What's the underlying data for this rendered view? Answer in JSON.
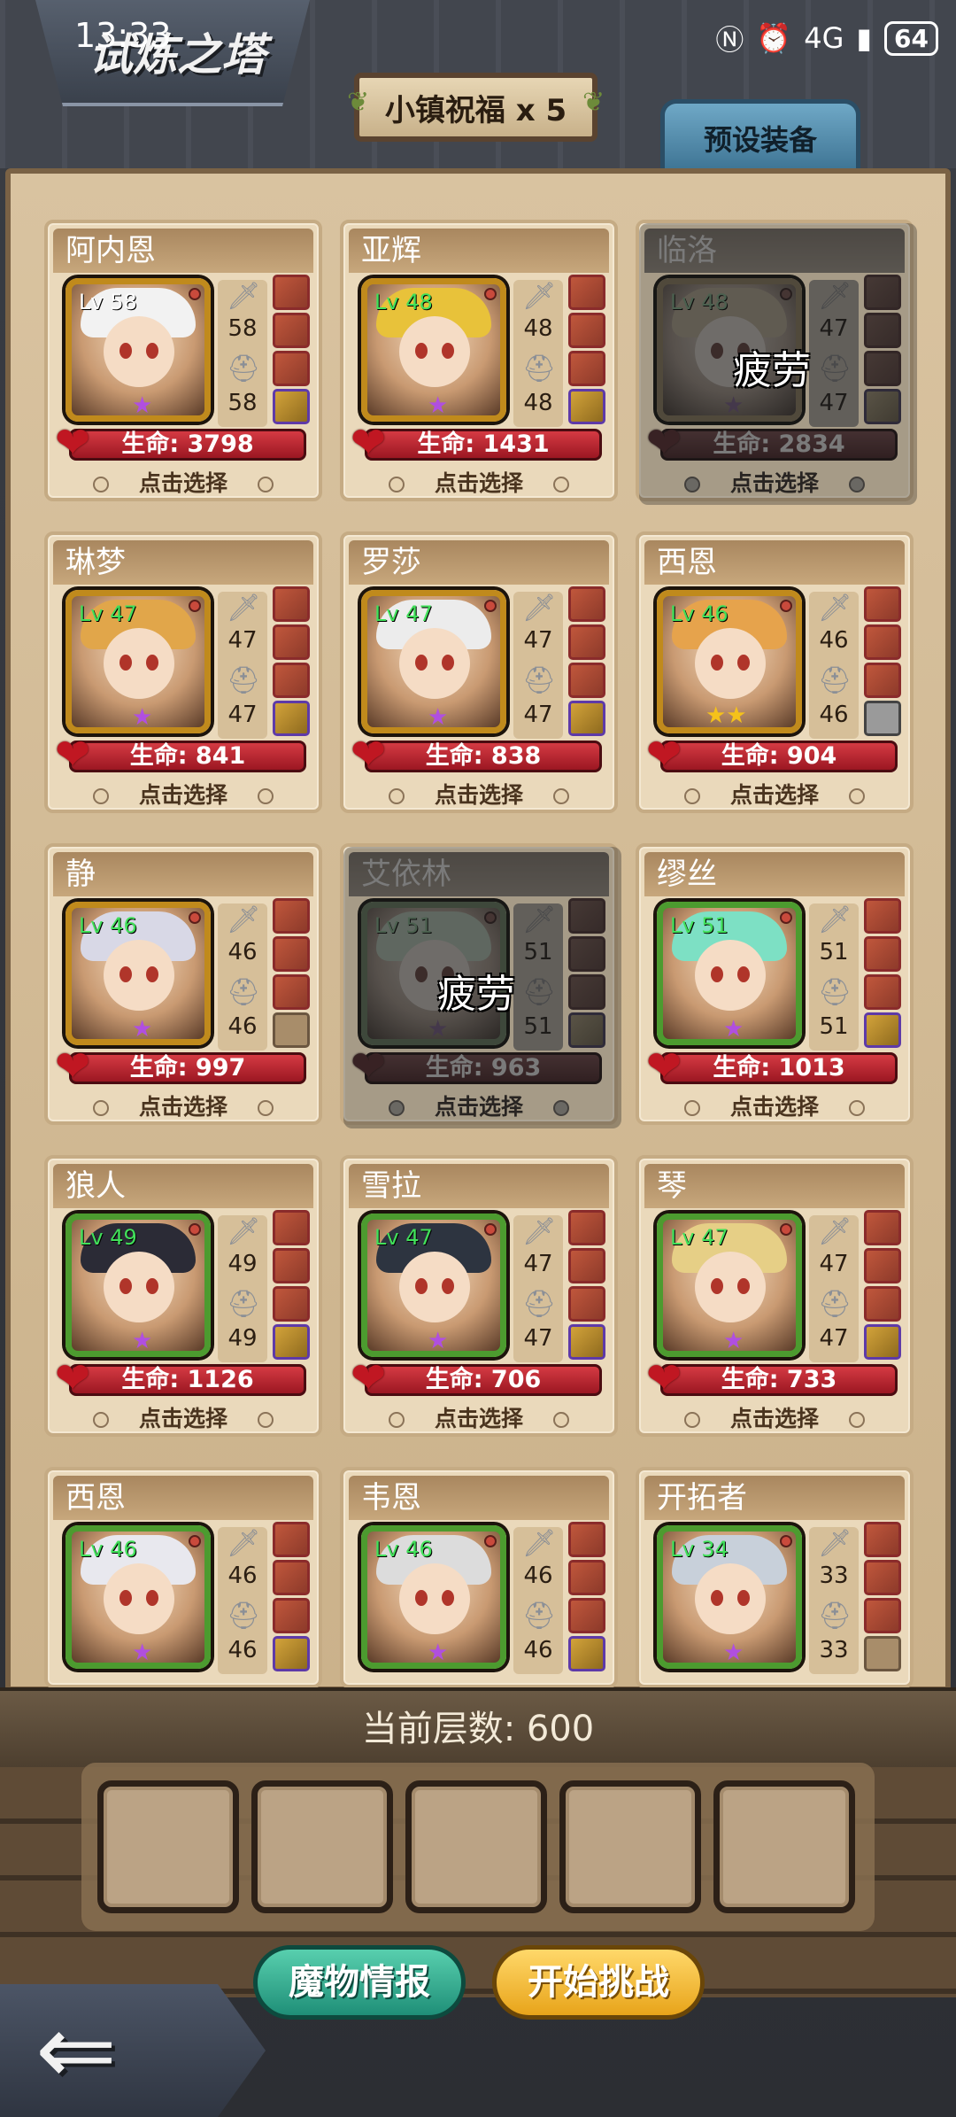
{
  "status_bar": {
    "time": "13:33",
    "signal": "4G",
    "battery": "64"
  },
  "header": {
    "title": "试炼之塔",
    "blessing": "小镇祝福 x 5",
    "preset_tab": "预设装备"
  },
  "heroes": [
    {
      "name": "阿内恩",
      "level": "Lv 58",
      "atk": "58",
      "def": "58",
      "hp": "生命: 3798",
      "select": "点击选择",
      "fatigued": false,
      "frame": "gold"
    },
    {
      "name": "亚辉",
      "level": "Lv 48",
      "atk": "48",
      "def": "48",
      "hp": "生命: 1431",
      "select": "点击选择",
      "fatigued": false,
      "frame": "gold"
    },
    {
      "name": "临洛",
      "level": "Lv 48",
      "atk": "47",
      "def": "47",
      "hp": "生命: 2834",
      "select": "点击选择",
      "fatigued": true,
      "fatigue_label": "疲劳",
      "frame": "gold"
    },
    {
      "name": "琳梦",
      "level": "Lv 47",
      "atk": "47",
      "def": "47",
      "hp": "生命: 841",
      "select": "点击选择",
      "fatigued": false,
      "frame": "gold"
    },
    {
      "name": "罗莎",
      "level": "Lv 47",
      "atk": "47",
      "def": "47",
      "hp": "生命: 838",
      "select": "点击选择",
      "fatigued": false,
      "frame": "gold"
    },
    {
      "name": "西恩",
      "level": "Lv 46",
      "atk": "46",
      "def": "46",
      "hp": "生命: 904",
      "select": "点击选择",
      "fatigued": false,
      "frame": "gold"
    },
    {
      "name": "静",
      "level": "Lv 46",
      "atk": "46",
      "def": "46",
      "hp": "生命: 997",
      "select": "点击选择",
      "fatigued": false,
      "frame": "gold"
    },
    {
      "name": "艾依林",
      "level": "Lv 51",
      "atk": "51",
      "def": "51",
      "hp": "生命: 963",
      "select": "点击选择",
      "fatigued": true,
      "fatigue_label": "疲劳",
      "frame": "green"
    },
    {
      "name": "缪丝",
      "level": "Lv 51",
      "atk": "51",
      "def": "51",
      "hp": "生命: 1013",
      "select": "点击选择",
      "fatigued": false,
      "frame": "green"
    },
    {
      "name": "狼人",
      "level": "Lv 49",
      "atk": "49",
      "def": "49",
      "hp": "生命: 1126",
      "select": "点击选择",
      "fatigued": false,
      "frame": "green"
    },
    {
      "name": "雪拉",
      "level": "Lv 47",
      "atk": "47",
      "def": "47",
      "hp": "生命: 706",
      "select": "点击选择",
      "fatigued": false,
      "frame": "green"
    },
    {
      "name": "琴",
      "level": "Lv 47",
      "atk": "47",
      "def": "47",
      "hp": "生命: 733",
      "select": "点击选择",
      "fatigued": false,
      "frame": "green"
    },
    {
      "name": "西恩",
      "level": "Lv 46",
      "atk": "46",
      "def": "46",
      "hp": "",
      "select": "",
      "fatigued": false,
      "frame": "green"
    },
    {
      "name": "韦恩",
      "level": "Lv 46",
      "atk": "46",
      "def": "46",
      "hp": "",
      "select": "",
      "fatigued": false,
      "frame": "green"
    },
    {
      "name": "开拓者",
      "level": "Lv 34",
      "atk": "33",
      "def": "33",
      "hp": "",
      "select": "",
      "fatigued": false,
      "frame": "green"
    }
  ],
  "floor": {
    "label": "当前层数: 600"
  },
  "buttons": {
    "monster_info": "魔物情报",
    "start": "开始挑战"
  }
}
